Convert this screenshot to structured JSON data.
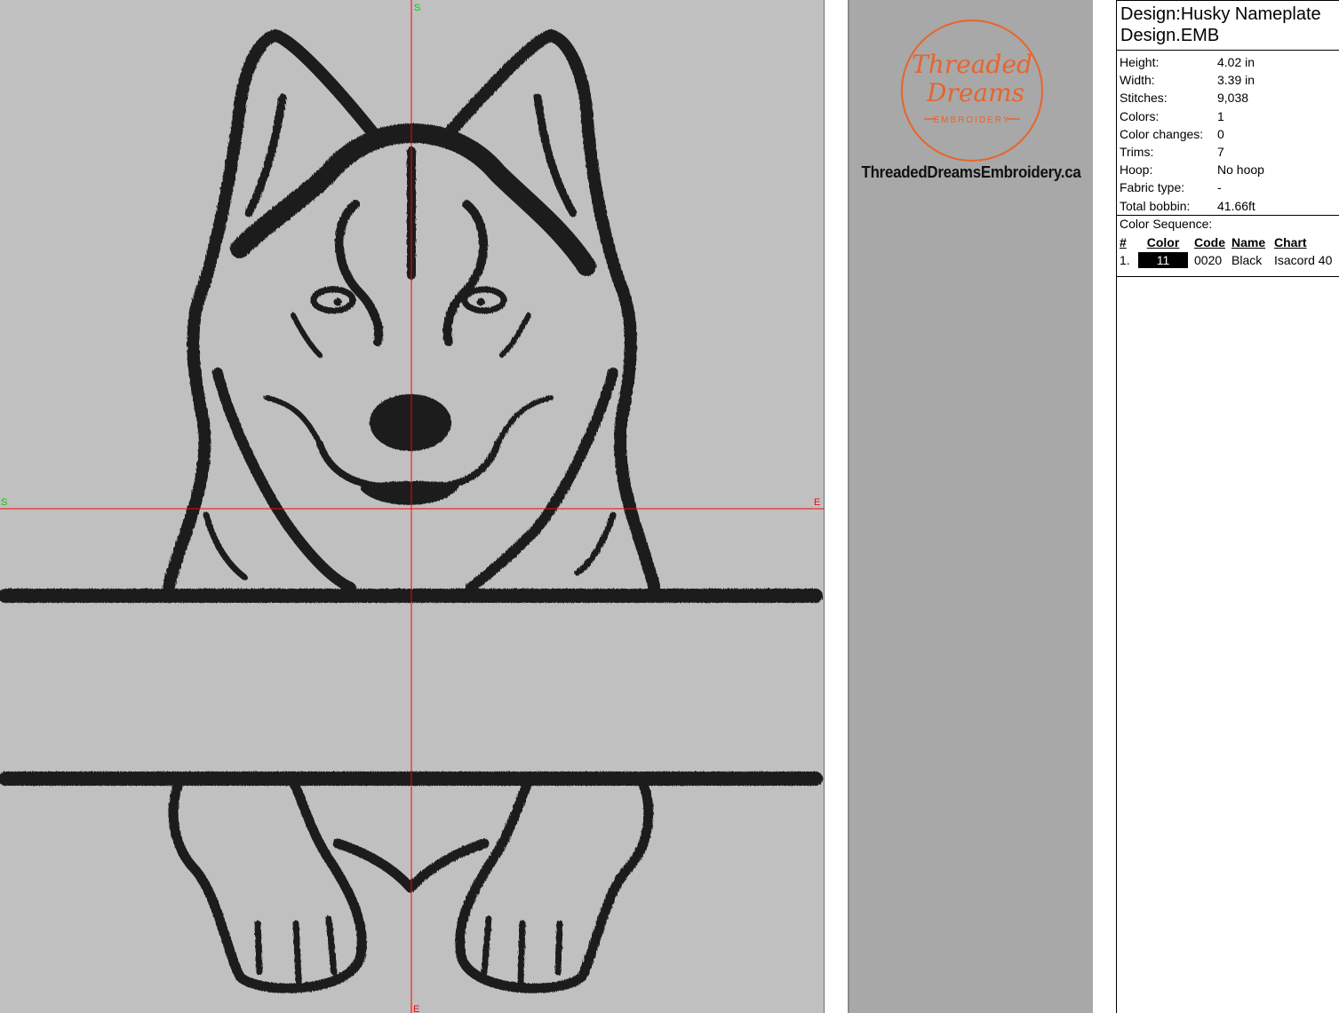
{
  "canvas": {
    "crosshair_color": "#ff0000",
    "marker_color": "#00cc00",
    "stitch_color": "#1f1f1f",
    "markers": {
      "top": "S",
      "left": "S",
      "right": "E",
      "bottom": "E"
    }
  },
  "logo": {
    "line1": "Threaded",
    "line2": "Dreams",
    "line3": "EMBROIDERY",
    "accent_color": "#e8642c",
    "website": "ThreadedDreamsEmbroidery.ca"
  },
  "info": {
    "title_line1": "Design:Husky Nameplate",
    "title_line2": "Design.EMB",
    "properties": [
      {
        "label": "Height:",
        "value": "4.02 in"
      },
      {
        "label": "Width:",
        "value": "3.39 in"
      },
      {
        "label": "Stitches:",
        "value": "9,038"
      },
      {
        "label": "Colors:",
        "value": "1"
      },
      {
        "label": "Color changes:",
        "value": "0"
      },
      {
        "label": "Trims:",
        "value": "7"
      },
      {
        "label": "Hoop:",
        "value": "No hoop"
      },
      {
        "label": "Fabric type:",
        "value": "-"
      },
      {
        "label": "Total bobbin:",
        "value": "41.66ft"
      }
    ],
    "sequence_title": "Color Sequence:",
    "sequence_headers": {
      "num": "#",
      "color": "Color",
      "code": "Code",
      "name": "Name",
      "chart": "Chart"
    },
    "sequence": [
      {
        "num": "1.",
        "color_label": "11",
        "swatch": "#000000",
        "code": "0020",
        "name": "Black",
        "chart": "Isacord 40"
      }
    ]
  }
}
